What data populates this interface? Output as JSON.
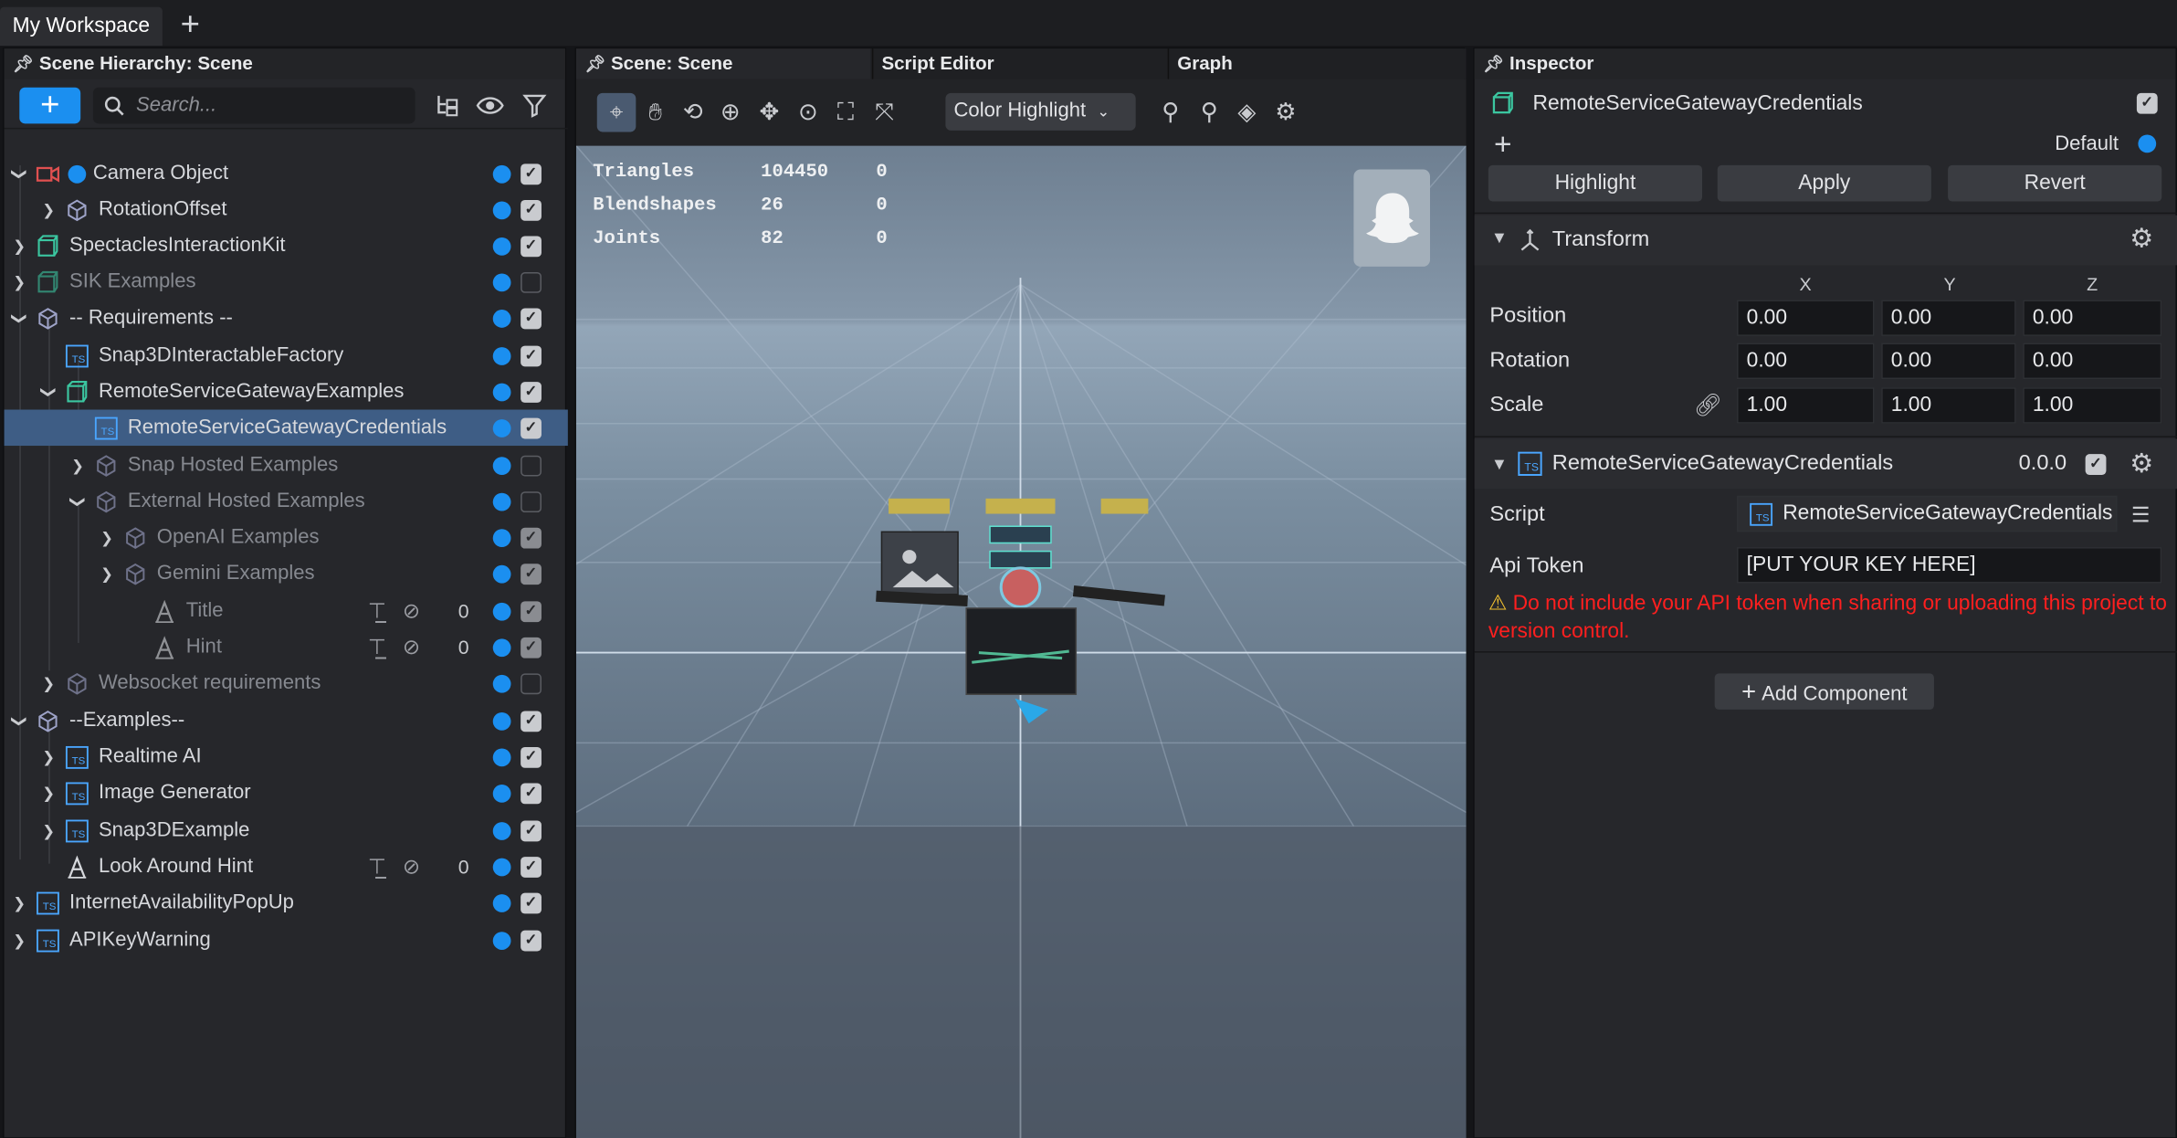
{
  "workspace": {
    "tab_label": "My Workspace",
    "add_label": "+"
  },
  "hierarchy": {
    "title": "Scene Hierarchy: Scene",
    "search_placeholder": "Search...",
    "rows": [
      {
        "label": "Camera Object",
        "checked": true,
        "dim": false
      },
      {
        "label": "RotationOffset",
        "checked": true,
        "dim": false
      },
      {
        "label": "SpectaclesInteractionKit",
        "checked": true,
        "dim": false
      },
      {
        "label": "SIK Examples",
        "checked": false,
        "dim": true
      },
      {
        "label": "-- Requirements --",
        "checked": true,
        "dim": false
      },
      {
        "label": "Snap3DInteractableFactory",
        "checked": true,
        "dim": false
      },
      {
        "label": "RemoteServiceGatewayExamples",
        "checked": true,
        "dim": false
      },
      {
        "label": "RemoteServiceGatewayCredentials",
        "checked": true,
        "dim": false,
        "selected": true
      },
      {
        "label": "Snap Hosted Examples",
        "checked": false,
        "dim": true
      },
      {
        "label": "External Hosted Examples",
        "checked": false,
        "dim": true
      },
      {
        "label": "OpenAI Examples",
        "checked": true,
        "dim": true
      },
      {
        "label": "Gemini Examples",
        "checked": true,
        "dim": true
      },
      {
        "label": "Title",
        "checked": true,
        "dim": true,
        "count": "0"
      },
      {
        "label": "Hint",
        "checked": true,
        "dim": true,
        "count": "0"
      },
      {
        "label": "Websocket requirements",
        "checked": false,
        "dim": true
      },
      {
        "label": "--Examples--",
        "checked": true,
        "dim": false
      },
      {
        "label": "Realtime AI",
        "checked": true,
        "dim": false
      },
      {
        "label": "Image Generator",
        "checked": true,
        "dim": false
      },
      {
        "label": "Snap3DExample",
        "checked": true,
        "dim": false
      },
      {
        "label": "Look Around Hint",
        "checked": true,
        "dim": false,
        "count": "0"
      },
      {
        "label": "InternetAvailabilityPopUp",
        "checked": true,
        "dim": false
      },
      {
        "label": "APIKeyWarning",
        "checked": true,
        "dim": false
      }
    ]
  },
  "scene": {
    "tabs": [
      "Scene: Scene",
      "Script Editor",
      "Graph"
    ],
    "color_highlight": "Color Highlight",
    "stats": [
      {
        "name": "Triangles",
        "value": "104450",
        "extra": "0"
      },
      {
        "name": "Blendshapes",
        "value": "26",
        "extra": "0"
      },
      {
        "name": "Joints",
        "value": "82",
        "extra": "0"
      }
    ]
  },
  "inspector": {
    "title": "Inspector",
    "object_name": "RemoteServiceGatewayCredentials",
    "layer_label": "Default",
    "buttons": {
      "highlight": "Highlight",
      "apply": "Apply",
      "revert": "Revert"
    },
    "transform": {
      "title": "Transform",
      "axes": [
        "X",
        "Y",
        "Z"
      ],
      "position_label": "Position",
      "position": [
        "0.00",
        "0.00",
        "0.00"
      ],
      "rotation_label": "Rotation",
      "rotation": [
        "0.00",
        "0.00",
        "0.00"
      ],
      "scale_label": "Scale",
      "scale": [
        "1.00",
        "1.00",
        "1.00"
      ]
    },
    "component": {
      "title": "RemoteServiceGatewayCredentials",
      "version": "0.0.0",
      "script_label": "Script",
      "script_value": "RemoteServiceGatewayCredentials",
      "api_label": "Api Token",
      "api_value": "[PUT YOUR KEY HERE]",
      "warning": "Do not include your API token when sharing or uploading this project to version control."
    },
    "add_component": "Add Component"
  },
  "colors": {
    "accent": "#1b8ff0",
    "selection": "#3e5d85",
    "warning": "#ff1f1f"
  }
}
